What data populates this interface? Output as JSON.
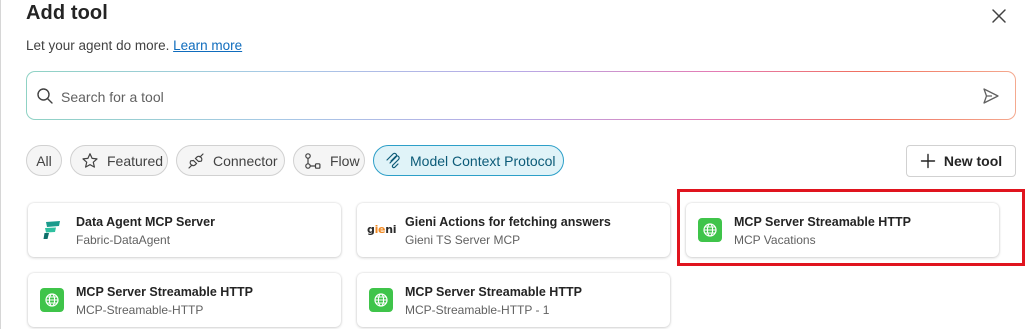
{
  "header": {
    "title": "Add tool",
    "subtitle": "Let your agent do more.",
    "learn_more": "Learn more"
  },
  "search": {
    "placeholder": "Search for a tool",
    "value": ""
  },
  "filters": [
    {
      "label": "All",
      "icon": "none",
      "active": false
    },
    {
      "label": "Featured",
      "icon": "star-icon",
      "active": false
    },
    {
      "label": "Connector",
      "icon": "connector-icon",
      "active": false
    },
    {
      "label": "Flow",
      "icon": "flow-icon",
      "active": false
    },
    {
      "label": "Model Context Protocol",
      "icon": "mcp-icon",
      "active": true
    }
  ],
  "actions": {
    "new_tool": "New tool"
  },
  "tools": [
    {
      "title": "Data Agent MCP Server",
      "subtitle": "Fabric-DataAgent",
      "icon": "fabric-icon"
    },
    {
      "title": "Gieni Actions for fetching answers",
      "subtitle": "Gieni TS Server MCP",
      "icon": "gieni-logo"
    },
    {
      "title": "MCP Server Streamable HTTP",
      "subtitle": "MCP Vacations",
      "icon": "globe-icon"
    },
    {
      "title": "MCP Server Streamable HTTP",
      "subtitle": "MCP-Streamable-HTTP",
      "icon": "globe-icon"
    },
    {
      "title": "MCP Server Streamable HTTP",
      "subtitle": "MCP-Streamable-HTTP - 1",
      "icon": "globe-icon"
    }
  ],
  "logo_text": {
    "gieni": "gieni"
  },
  "colors": {
    "accent": "#0f6cbd",
    "active_chip_bg": "#e0f3f8",
    "active_chip_border": "#2d9fc8",
    "mcp_green": "#3fc44a",
    "highlight": "#e0141e"
  }
}
